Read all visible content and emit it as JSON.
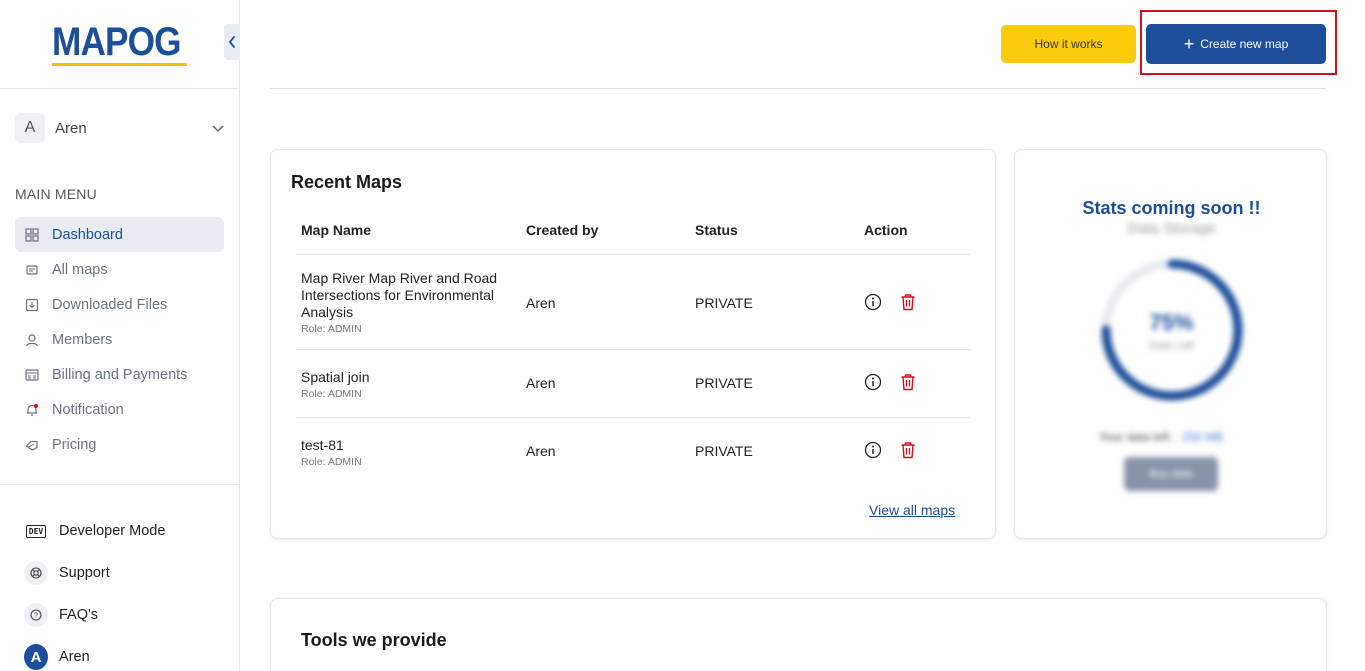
{
  "app": {
    "logo_text": "MAPOG"
  },
  "user": {
    "initial": "A",
    "name": "Aren"
  },
  "menu": {
    "title": "MAIN MENU",
    "items": [
      {
        "label": "Dashboard",
        "icon": "grid-icon",
        "active": true
      },
      {
        "label": "All maps",
        "icon": "map-icon"
      },
      {
        "label": "Downloaded Files",
        "icon": "download-icon"
      },
      {
        "label": "Members",
        "icon": "user-icon"
      },
      {
        "label": "Billing and Payments",
        "icon": "billing-icon"
      },
      {
        "label": "Notification",
        "icon": "bell-icon"
      },
      {
        "label": "Pricing",
        "icon": "tag-icon"
      }
    ]
  },
  "bottom_menu": {
    "developer_label": "Developer Mode",
    "developer_badge": "DEV",
    "support_label": "Support",
    "faq_label": "FAQ's",
    "profile_initial": "A",
    "profile_name": "Aren"
  },
  "header": {
    "how_it_works": "How it works",
    "create_new_map": "Create new map"
  },
  "recent_maps": {
    "title": "Recent Maps",
    "columns": [
      "Map Name",
      "Created by",
      "Status",
      "Action"
    ],
    "rows": [
      {
        "name": "Map River Map River and Road Intersections for Environmental Analysis",
        "role": "Role: ADMIN",
        "created_by": "Aren",
        "status": "PRIVATE"
      },
      {
        "name": "Spatial join",
        "role": "Role: ADMIN",
        "created_by": "Aren",
        "status": "PRIVATE"
      },
      {
        "name": "test-81",
        "role": "Role: ADMIN",
        "created_by": "Aren",
        "status": "PRIVATE"
      }
    ],
    "view_all": "View all maps"
  },
  "stats": {
    "title": "Stats coming soon !!",
    "data_storage_label": "Data Storage",
    "percent_value": 0.75,
    "percent_label": "75%",
    "percent_sub": "Data Left",
    "data_left_label": "Your data left :",
    "data_left_value": "250 MB",
    "buy_button": "Buy data",
    "colors": {
      "gauge": "#1d4e99",
      "gauge_track": "#e6e9ee"
    }
  },
  "tools": {
    "title": "Tools we provide"
  },
  "colors": {
    "primary": "#1d4e99",
    "accent": "#fccc0a",
    "danger": "#d0101a"
  }
}
